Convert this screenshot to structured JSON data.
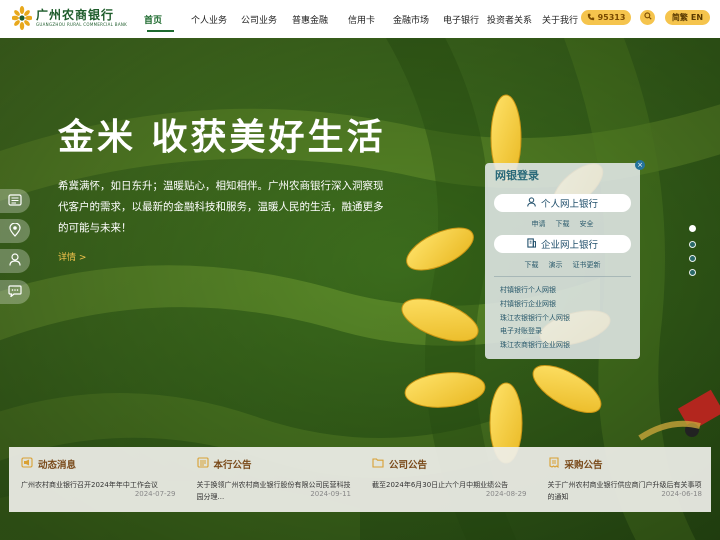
{
  "brand": {
    "name_cn": "广州农商银行",
    "name_en": "GUANGZHOU RURAL COMMERCIAL BANK",
    "primary_color": "#1d5b2a",
    "accent_color": "#f5c44d"
  },
  "nav": {
    "items": [
      {
        "label": "首页",
        "active": true
      },
      {
        "label": "个人业务",
        "active": false
      },
      {
        "label": "公司业务",
        "active": false
      },
      {
        "label": "普惠金融",
        "active": false
      },
      {
        "label": "信用卡",
        "active": false
      },
      {
        "label": "金融市场",
        "active": false
      },
      {
        "label": "电子银行",
        "active": false
      },
      {
        "label": "投资者关系",
        "active": false
      },
      {
        "label": "关于我行",
        "active": false
      }
    ],
    "hotline": "95313",
    "lang_cn": "简繁",
    "lang_en": "EN"
  },
  "hero": {
    "title": "金米 收获美好生活",
    "description": "希冀满怀，如日东升；温暖贴心，相知相伴。广州农商银行深入洞察现代客户的需求，以最新的金融科技和服务，温暖人民的生活，融通更多的可能与未来！",
    "more": "详情 >",
    "slide_count": 4,
    "active_slide": 1
  },
  "side_tools": [
    "id-card-icon",
    "location-pin-icon",
    "user-icon",
    "chat-bubble-icon"
  ],
  "ebank": {
    "title": "网银登录",
    "close": "×",
    "personal": {
      "label": "个人网上银行",
      "links": [
        "申请",
        "下载",
        "安全"
      ]
    },
    "corporate": {
      "label": "企业网上银行",
      "links": [
        "下载",
        "演示",
        "证书更新"
      ]
    },
    "list": [
      "村镇银行个人网银",
      "村镇银行企业网银",
      "珠江农银银行个人网银",
      "电子对账登录",
      "珠江农商银行企业网银"
    ]
  },
  "news": [
    {
      "title": "动态消息",
      "icon": "megaphone-icon",
      "text": "广州农村商业银行召开2024年年中工作会议",
      "date": "2024-07-29"
    },
    {
      "title": "本行公告",
      "icon": "notice-board-icon",
      "text": "关于换领广州农村商业银行股份有限公司民营科技园分理...",
      "date": "2024-09-11"
    },
    {
      "title": "公司公告",
      "icon": "folder-icon",
      "text": "截至2024年6月30日止六个月中期业绩公告",
      "date": "2024-08-29"
    },
    {
      "title": "采购公告",
      "icon": "receipt-icon",
      "text": "关于广州农村商业银行供应商门户升级后有关事项的通知",
      "date": "2024-06-18"
    }
  ]
}
